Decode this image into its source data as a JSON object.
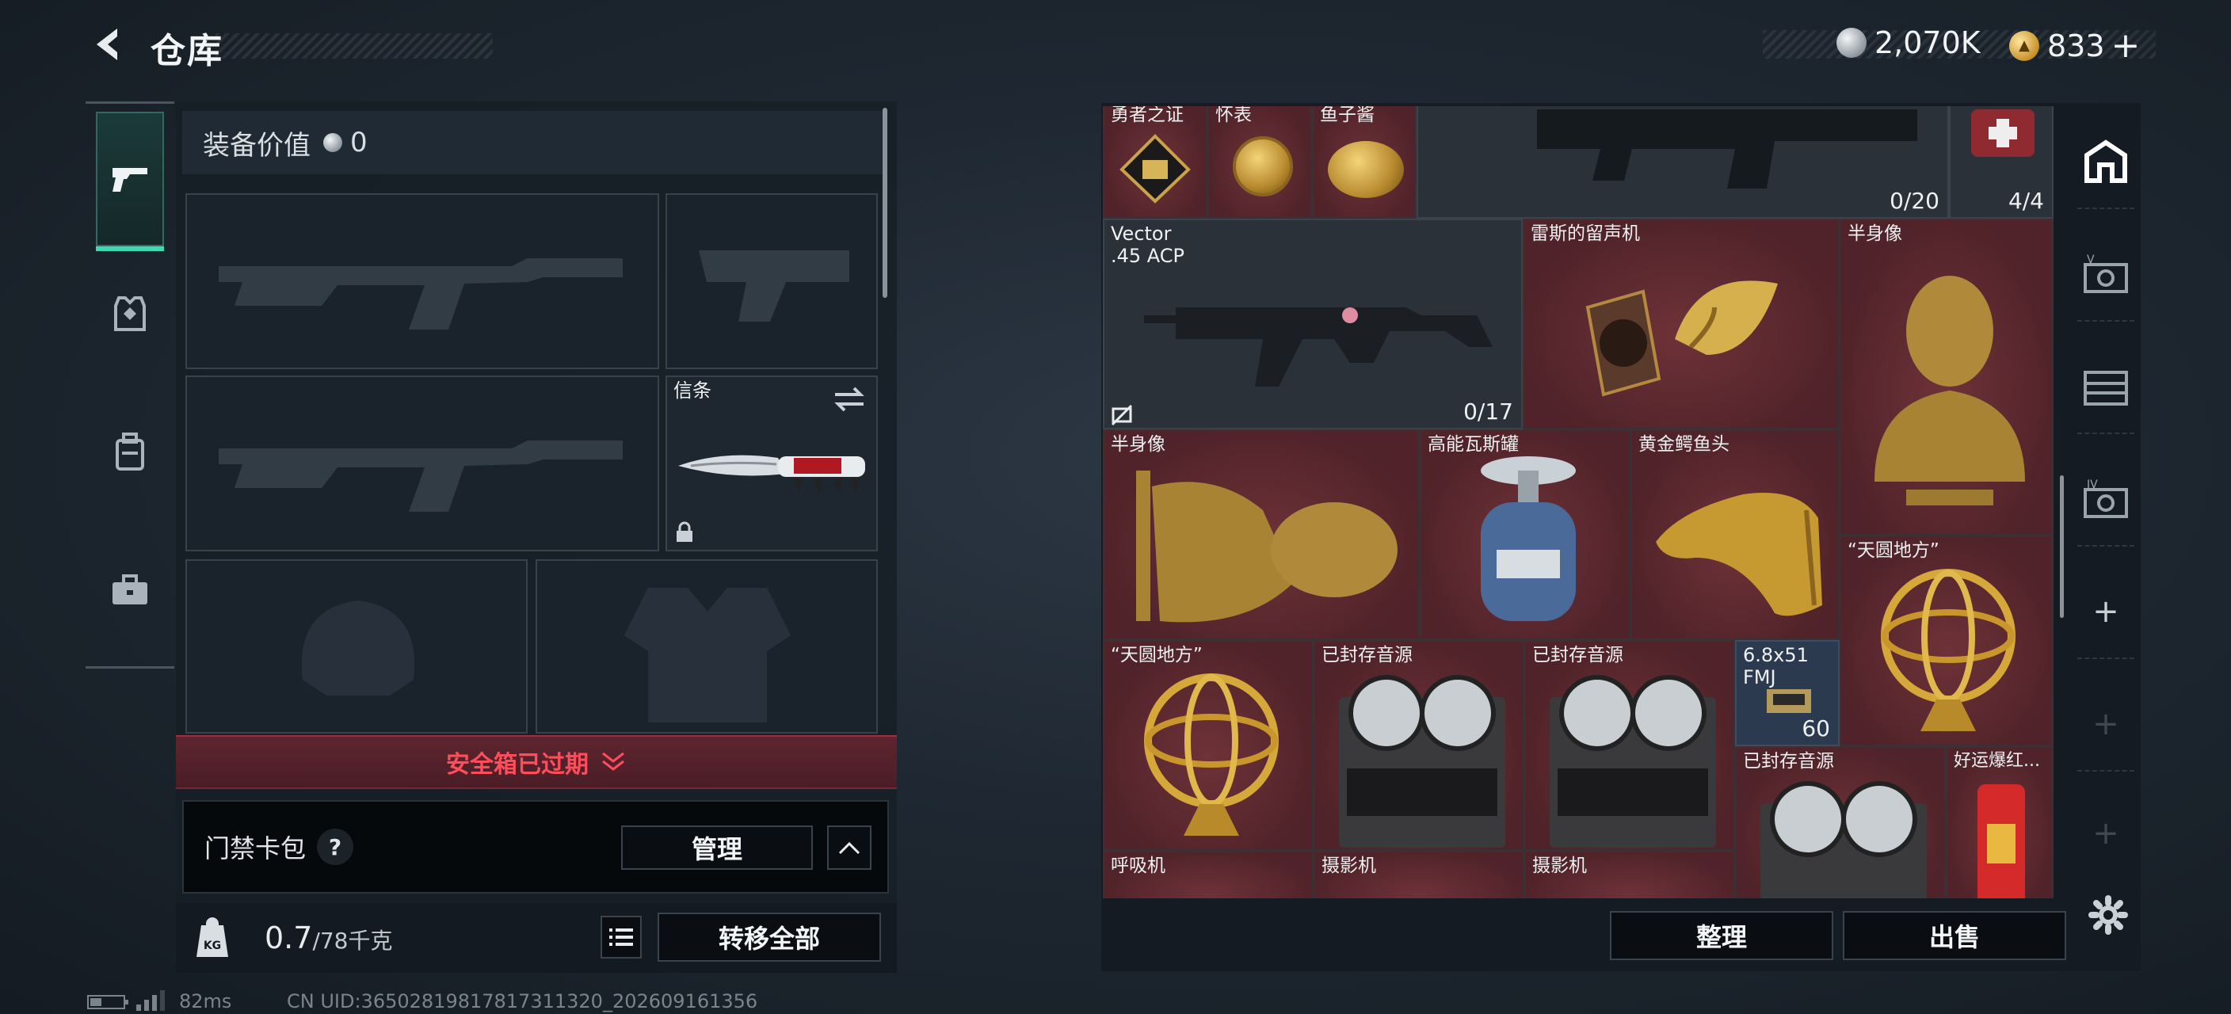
{
  "header": {
    "title": "仓库",
    "currency_silver": "2,070K",
    "currency_gold": "833",
    "gold_plus": "+"
  },
  "left_sidebar": {
    "tabs": [
      {
        "icon": "pistol-icon",
        "active": true
      },
      {
        "icon": "armor-icon"
      },
      {
        "icon": "backpack-icon"
      },
      {
        "icon": "toolbox-icon"
      }
    ]
  },
  "loadout": {
    "equipment_value_label": "装备价值",
    "equipment_value": "0",
    "melee_label": "信条",
    "safe_box_status": "安全箱已过期",
    "access_card_label": "门禁卡包",
    "access_card_help": "?",
    "manage_label": "管理",
    "weight_value": "0.7",
    "weight_max": "/78千克",
    "transfer_all_label": "转移全部"
  },
  "stash": {
    "items": [
      {
        "id": "brave-badge",
        "label": "勇者之证"
      },
      {
        "id": "pocket-watch",
        "label": "怀表"
      },
      {
        "id": "caviar",
        "label": "鱼子酱"
      },
      {
        "id": "rifle-top",
        "count": "0/20"
      },
      {
        "id": "medkit",
        "count": "4/4"
      },
      {
        "id": "vector",
        "label": "Vector\n.45 ACP",
        "count": "0/17"
      },
      {
        "id": "phonograph",
        "label": "雷斯的留声机"
      },
      {
        "id": "bust-tall",
        "label": "半身像"
      },
      {
        "id": "bust-lying",
        "label": "半身像"
      },
      {
        "id": "gas-tank",
        "label": "高能瓦斯罐"
      },
      {
        "id": "croc-head",
        "label": "黄金鳄鱼头"
      },
      {
        "id": "armillary-2",
        "label": "“天圆地方”"
      },
      {
        "id": "armillary-1",
        "label": "“天圆地方”"
      },
      {
        "id": "reel-1",
        "label": "已封存音源"
      },
      {
        "id": "reel-2",
        "label": "已封存音源"
      },
      {
        "id": "ammo",
        "label": "6.8x51\nFMJ",
        "count": "60"
      },
      {
        "id": "reel-3",
        "label": "已封存音源"
      },
      {
        "id": "firecracker",
        "label": "好运爆红..."
      },
      {
        "id": "respirator",
        "label": "呼吸机"
      },
      {
        "id": "camera-1",
        "label": "摄影机"
      },
      {
        "id": "camera-2",
        "label": "摄影机"
      }
    ],
    "sort_label": "整理",
    "sell_label": "出售"
  },
  "status_bar": {
    "ping": "82ms",
    "uid": "CN UID:36502819817817311320_202609161356"
  },
  "colors": {
    "accent": "#3fd8b0",
    "alert": "#ff4e5a",
    "cell": "#5a272d"
  }
}
